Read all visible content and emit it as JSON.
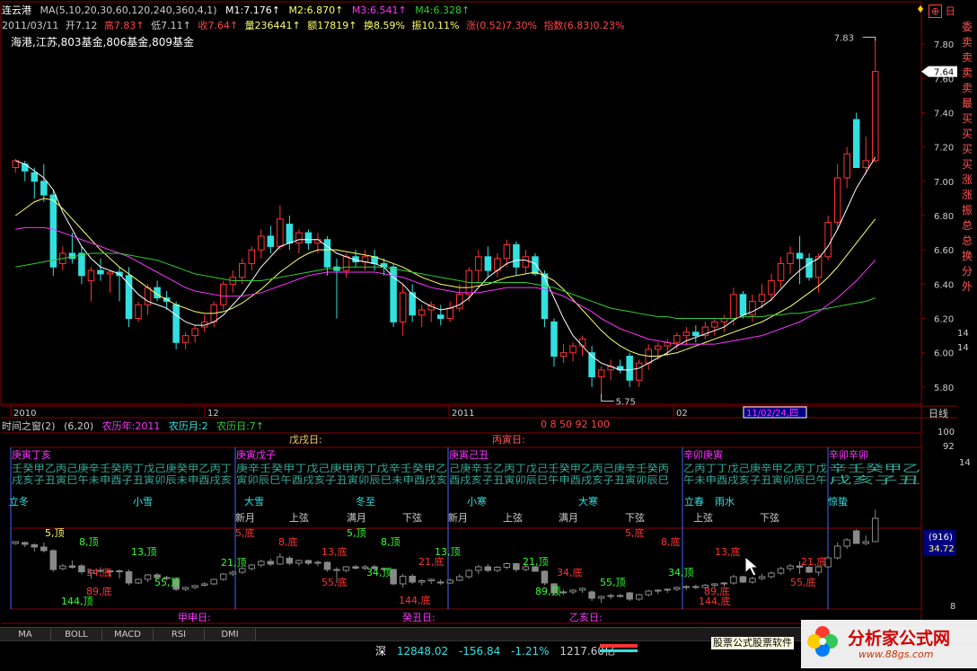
{
  "header": {
    "stock_name": "连云港",
    "ma_params": "MA(5,10,20,30,60,120,240,360,4,1)",
    "m1": "M1:7.176↑",
    "m2": "M2:6.870↑",
    "m3": "M3:6.541↑",
    "m4": "M4:6.328↑",
    "date": "2011/03/11",
    "open": "开7.12",
    "high": "高7.83↑",
    "low": "低7.11↑",
    "close": "收7.64↑",
    "volume": "量236441↑",
    "amount": "额17819↑",
    "turnover": "换8.59%",
    "amplitude": "振10.11%",
    "change": "涨(0.52)7.30%",
    "index": "指数(6.83)0.23%",
    "tags": "海港,江苏,803基金,806基金,809基金"
  },
  "top_right": {
    "tabs_label": "日"
  },
  "colors": {
    "bg": "#000000",
    "up": "#ff3333",
    "down": "#33e0e0",
    "ma_white": "#ffffff",
    "ma_yellow": "#ffff66",
    "ma_green": "#33cc33",
    "ma_magenta": "#ff33ff",
    "grid": "#8b0000",
    "axis_text": "#cccccc"
  },
  "price_axis": {
    "ticks": [
      "7.80",
      "7.60",
      "7.40",
      "7.20",
      "7.00",
      "6.80",
      "6.60",
      "6.40",
      "6.20",
      "6.00",
      "5.80"
    ],
    "current_price": "7.64",
    "high_label": "7.83",
    "low_label": "5.75",
    "side_labels": [
      "14",
      "14"
    ]
  },
  "date_axis": {
    "labels": [
      "2010",
      "12",
      "2011",
      "02"
    ],
    "cursor_date": "11/02/24,四",
    "period": "日线"
  },
  "sidebar": {
    "labels": [
      "委",
      "卖",
      "卖",
      "卖",
      "卖",
      "最",
      "买",
      "买",
      "买",
      "买",
      "涨",
      "涨",
      "振",
      "总",
      "总",
      "换",
      "分",
      "外"
    ]
  },
  "chart_data": {
    "type": "candlestick",
    "ylim": [
      5.7,
      7.9
    ],
    "candles": [
      {
        "o": 7.08,
        "h": 7.13,
        "l": 7.05,
        "c": 7.12
      },
      {
        "o": 7.1,
        "h": 7.12,
        "l": 7.0,
        "c": 7.06
      },
      {
        "o": 7.05,
        "h": 7.08,
        "l": 6.9,
        "c": 7.0
      },
      {
        "o": 7.0,
        "h": 7.1,
        "l": 6.88,
        "c": 6.92
      },
      {
        "o": 6.92,
        "h": 6.95,
        "l": 6.45,
        "c": 6.5
      },
      {
        "o": 6.52,
        "h": 6.62,
        "l": 6.48,
        "c": 6.58
      },
      {
        "o": 6.58,
        "h": 6.7,
        "l": 6.52,
        "c": 6.55
      },
      {
        "o": 6.58,
        "h": 6.62,
        "l": 6.4,
        "c": 6.45
      },
      {
        "o": 6.42,
        "h": 6.5,
        "l": 6.3,
        "c": 6.48
      },
      {
        "o": 6.48,
        "h": 6.55,
        "l": 6.42,
        "c": 6.46
      },
      {
        "o": 6.46,
        "h": 6.48,
        "l": 6.35,
        "c": 6.47
      },
      {
        "o": 6.47,
        "h": 6.5,
        "l": 6.3,
        "c": 6.45
      },
      {
        "o": 6.45,
        "h": 6.5,
        "l": 6.15,
        "c": 6.2
      },
      {
        "o": 6.2,
        "h": 6.3,
        "l": 6.18,
        "c": 6.28
      },
      {
        "o": 6.28,
        "h": 6.4,
        "l": 6.22,
        "c": 6.38
      },
      {
        "o": 6.38,
        "h": 6.42,
        "l": 6.3,
        "c": 6.32
      },
      {
        "o": 6.32,
        "h": 6.36,
        "l": 6.25,
        "c": 6.3
      },
      {
        "o": 6.28,
        "h": 6.3,
        "l": 6.02,
        "c": 6.06
      },
      {
        "o": 6.06,
        "h": 6.12,
        "l": 6.02,
        "c": 6.1
      },
      {
        "o": 6.1,
        "h": 6.16,
        "l": 6.06,
        "c": 6.14
      },
      {
        "o": 6.15,
        "h": 6.22,
        "l": 6.12,
        "c": 6.18
      },
      {
        "o": 6.18,
        "h": 6.3,
        "l": 6.15,
        "c": 6.28
      },
      {
        "o": 6.28,
        "h": 6.42,
        "l": 6.25,
        "c": 6.4
      },
      {
        "o": 6.4,
        "h": 6.48,
        "l": 6.35,
        "c": 6.44
      },
      {
        "o": 6.44,
        "h": 6.55,
        "l": 6.4,
        "c": 6.52
      },
      {
        "o": 6.52,
        "h": 6.62,
        "l": 6.48,
        "c": 6.6
      },
      {
        "o": 6.6,
        "h": 6.72,
        "l": 6.55,
        "c": 6.68
      },
      {
        "o": 6.68,
        "h": 6.74,
        "l": 6.58,
        "c": 6.62
      },
      {
        "o": 6.62,
        "h": 6.86,
        "l": 6.6,
        "c": 6.78
      },
      {
        "o": 6.75,
        "h": 6.8,
        "l": 6.6,
        "c": 6.64
      },
      {
        "o": 6.64,
        "h": 6.72,
        "l": 6.58,
        "c": 6.7
      },
      {
        "o": 6.7,
        "h": 6.72,
        "l": 6.6,
        "c": 6.64
      },
      {
        "o": 6.64,
        "h": 6.7,
        "l": 6.58,
        "c": 6.66
      },
      {
        "o": 6.66,
        "h": 6.68,
        "l": 6.45,
        "c": 6.5
      },
      {
        "o": 6.5,
        "h": 6.55,
        "l": 6.2,
        "c": 6.48
      },
      {
        "o": 6.48,
        "h": 6.58,
        "l": 6.44,
        "c": 6.56
      },
      {
        "o": 6.56,
        "h": 6.6,
        "l": 6.5,
        "c": 6.53
      },
      {
        "o": 6.53,
        "h": 6.6,
        "l": 6.48,
        "c": 6.56
      },
      {
        "o": 6.56,
        "h": 6.6,
        "l": 6.48,
        "c": 6.52
      },
      {
        "o": 6.52,
        "h": 6.55,
        "l": 6.45,
        "c": 6.5
      },
      {
        "o": 6.5,
        "h": 6.52,
        "l": 6.15,
        "c": 6.18
      },
      {
        "o": 6.18,
        "h": 6.4,
        "l": 6.1,
        "c": 6.35
      },
      {
        "o": 6.35,
        "h": 6.4,
        "l": 6.18,
        "c": 6.22
      },
      {
        "o": 6.22,
        "h": 6.28,
        "l": 6.15,
        "c": 6.25
      },
      {
        "o": 6.25,
        "h": 6.3,
        "l": 6.18,
        "c": 6.28
      },
      {
        "o": 6.22,
        "h": 6.28,
        "l": 6.16,
        "c": 6.2
      },
      {
        "o": 6.2,
        "h": 6.3,
        "l": 6.18,
        "c": 6.26
      },
      {
        "o": 6.26,
        "h": 6.4,
        "l": 6.24,
        "c": 6.34
      },
      {
        "o": 6.34,
        "h": 6.5,
        "l": 6.3,
        "c": 6.48
      },
      {
        "o": 6.48,
        "h": 6.6,
        "l": 6.4,
        "c": 6.56
      },
      {
        "o": 6.56,
        "h": 6.62,
        "l": 6.44,
        "c": 6.48
      },
      {
        "o": 6.48,
        "h": 6.58,
        "l": 6.44,
        "c": 6.55
      },
      {
        "o": 6.55,
        "h": 6.66,
        "l": 6.5,
        "c": 6.63
      },
      {
        "o": 6.63,
        "h": 6.65,
        "l": 6.45,
        "c": 6.5
      },
      {
        "o": 6.5,
        "h": 6.6,
        "l": 6.46,
        "c": 6.56
      },
      {
        "o": 6.56,
        "h": 6.58,
        "l": 6.45,
        "c": 6.46
      },
      {
        "o": 6.46,
        "h": 6.48,
        "l": 6.15,
        "c": 6.2
      },
      {
        "o": 6.18,
        "h": 6.2,
        "l": 5.92,
        "c": 5.98
      },
      {
        "o": 5.98,
        "h": 6.05,
        "l": 5.94,
        "c": 6.0
      },
      {
        "o": 6.0,
        "h": 6.06,
        "l": 5.95,
        "c": 6.04
      },
      {
        "o": 6.04,
        "h": 6.1,
        "l": 5.98,
        "c": 6.08
      },
      {
        "o": 6.0,
        "h": 6.04,
        "l": 5.8,
        "c": 5.86
      },
      {
        "o": 5.86,
        "h": 5.92,
        "l": 5.75,
        "c": 5.9
      },
      {
        "o": 5.9,
        "h": 5.96,
        "l": 5.84,
        "c": 5.92
      },
      {
        "o": 5.92,
        "h": 5.96,
        "l": 5.88,
        "c": 5.9
      },
      {
        "o": 5.98,
        "h": 6.0,
        "l": 5.8,
        "c": 5.84
      },
      {
        "o": 5.84,
        "h": 5.96,
        "l": 5.8,
        "c": 5.94
      },
      {
        "o": 5.94,
        "h": 6.05,
        "l": 5.9,
        "c": 6.02
      },
      {
        "o": 6.02,
        "h": 6.06,
        "l": 5.96,
        "c": 6.04
      },
      {
        "o": 6.04,
        "h": 6.08,
        "l": 5.98,
        "c": 6.06
      },
      {
        "o": 6.06,
        "h": 6.12,
        "l": 6.02,
        "c": 6.1
      },
      {
        "o": 6.1,
        "h": 6.15,
        "l": 6.04,
        "c": 6.12
      },
      {
        "o": 6.12,
        "h": 6.16,
        "l": 6.06,
        "c": 6.1
      },
      {
        "o": 6.1,
        "h": 6.18,
        "l": 6.08,
        "c": 6.15
      },
      {
        "o": 6.15,
        "h": 6.2,
        "l": 6.1,
        "c": 6.18
      },
      {
        "o": 6.18,
        "h": 6.22,
        "l": 6.12,
        "c": 6.2
      },
      {
        "o": 6.2,
        "h": 6.38,
        "l": 6.16,
        "c": 6.34
      },
      {
        "o": 6.34,
        "h": 6.36,
        "l": 6.2,
        "c": 6.22
      },
      {
        "o": 6.22,
        "h": 6.34,
        "l": 6.18,
        "c": 6.3
      },
      {
        "o": 6.3,
        "h": 6.4,
        "l": 6.26,
        "c": 6.34
      },
      {
        "o": 6.34,
        "h": 6.46,
        "l": 6.3,
        "c": 6.42
      },
      {
        "o": 6.42,
        "h": 6.56,
        "l": 6.38,
        "c": 6.52
      },
      {
        "o": 6.52,
        "h": 6.62,
        "l": 6.46,
        "c": 6.58
      },
      {
        "o": 6.58,
        "h": 6.68,
        "l": 6.4,
        "c": 6.55
      },
      {
        "o": 6.55,
        "h": 6.58,
        "l": 6.42,
        "c": 6.44
      },
      {
        "o": 6.44,
        "h": 6.58,
        "l": 6.35,
        "c": 6.56
      },
      {
        "o": 6.56,
        "h": 6.8,
        "l": 6.54,
        "c": 6.76
      },
      {
        "o": 6.76,
        "h": 7.1,
        "l": 6.72,
        "c": 7.02
      },
      {
        "o": 7.02,
        "h": 7.2,
        "l": 6.96,
        "c": 7.16
      },
      {
        "o": 7.36,
        "h": 7.4,
        "l": 7.08,
        "c": 7.08
      },
      {
        "o": 7.08,
        "h": 7.26,
        "l": 7.04,
        "c": 7.12
      },
      {
        "o": 7.12,
        "h": 7.83,
        "l": 7.11,
        "c": 7.64
      }
    ],
    "series": [
      {
        "name": "M1",
        "values": [
          7.12,
          7.1,
          7.06,
          7.02,
          6.95,
          6.82,
          6.72,
          6.62,
          6.55,
          6.5,
          6.48,
          6.46,
          6.4,
          6.34,
          6.3,
          6.28,
          6.26,
          6.22,
          6.18,
          6.16,
          6.16,
          6.18,
          6.22,
          6.28,
          6.34,
          6.42,
          6.5,
          6.56,
          6.62,
          6.64,
          6.66,
          6.66,
          6.66,
          6.62,
          6.58,
          6.56,
          6.54,
          6.53,
          6.52,
          6.5,
          6.44,
          6.4,
          6.34,
          6.3,
          6.27,
          6.25,
          6.26,
          6.28,
          6.32,
          6.38,
          6.44,
          6.48,
          6.52,
          6.54,
          6.54,
          6.52,
          6.44,
          6.32,
          6.2,
          6.1,
          6.04,
          5.98,
          5.94,
          5.92,
          5.9,
          5.9,
          5.91,
          5.94,
          5.97,
          6.0,
          6.04,
          6.07,
          6.09,
          6.11,
          6.13,
          6.15,
          6.19,
          6.22,
          6.24,
          6.27,
          6.31,
          6.37,
          6.43,
          6.48,
          6.52,
          6.55,
          6.62,
          6.72,
          6.84,
          6.96,
          7.05,
          7.14
        ]
      },
      {
        "name": "M2",
        "values": [
          6.8,
          6.84,
          6.88,
          6.9,
          6.89,
          6.84,
          6.78,
          6.72,
          6.66,
          6.6,
          6.55,
          6.5,
          6.46,
          6.42,
          6.38,
          6.34,
          6.31,
          6.28,
          6.26,
          6.24,
          6.23,
          6.23,
          6.24,
          6.26,
          6.29,
          6.33,
          6.37,
          6.42,
          6.47,
          6.51,
          6.55,
          6.58,
          6.6,
          6.6,
          6.6,
          6.59,
          6.58,
          6.57,
          6.56,
          6.54,
          6.52,
          6.5,
          6.47,
          6.44,
          6.42,
          6.4,
          6.39,
          6.38,
          6.38,
          6.39,
          6.4,
          6.42,
          6.44,
          6.45,
          6.46,
          6.47,
          6.45,
          6.42,
          6.37,
          6.31,
          6.25,
          6.19,
          6.13,
          6.08,
          6.04,
          6.01,
          5.99,
          5.98,
          5.98,
          5.99,
          6.0,
          6.02,
          6.04,
          6.06,
          6.08,
          6.1,
          6.12,
          6.14,
          6.16,
          6.18,
          6.21,
          6.24,
          6.27,
          6.31,
          6.35,
          6.39,
          6.44,
          6.5,
          6.57,
          6.64,
          6.71,
          6.78
        ]
      },
      {
        "name": "M3",
        "values": [
          6.72,
          6.73,
          6.73,
          6.73,
          6.72,
          6.7,
          6.68,
          6.66,
          6.64,
          6.62,
          6.6,
          6.58,
          6.56,
          6.53,
          6.5,
          6.47,
          6.44,
          6.41,
          6.38,
          6.36,
          6.35,
          6.34,
          6.33,
          6.33,
          6.33,
          6.34,
          6.35,
          6.37,
          6.39,
          6.41,
          6.43,
          6.45,
          6.46,
          6.47,
          6.47,
          6.47,
          6.47,
          6.47,
          6.47,
          6.46,
          6.45,
          6.44,
          6.42,
          6.4,
          6.38,
          6.37,
          6.36,
          6.35,
          6.35,
          6.35,
          6.36,
          6.37,
          6.38,
          6.38,
          6.38,
          6.38,
          6.37,
          6.35,
          6.33,
          6.3,
          6.27,
          6.24,
          6.2,
          6.17,
          6.14,
          6.12,
          6.1,
          6.08,
          6.07,
          6.06,
          6.05,
          6.05,
          6.05,
          6.05,
          6.05,
          6.06,
          6.07,
          6.08,
          6.09,
          6.1,
          6.12,
          6.14,
          6.16,
          6.18,
          6.21,
          6.24,
          6.28,
          6.32,
          6.37,
          6.42,
          6.48,
          6.54
        ]
      },
      {
        "name": "M4",
        "values": [
          6.5,
          6.51,
          6.52,
          6.53,
          6.54,
          6.55,
          6.56,
          6.57,
          6.58,
          6.58,
          6.58,
          6.58,
          6.57,
          6.56,
          6.55,
          6.54,
          6.52,
          6.5,
          6.48,
          6.46,
          6.45,
          6.44,
          6.43,
          6.42,
          6.42,
          6.42,
          6.42,
          6.43,
          6.44,
          6.45,
          6.46,
          6.47,
          6.48,
          6.49,
          6.49,
          6.5,
          6.5,
          6.5,
          6.5,
          6.5,
          6.49,
          6.48,
          6.47,
          6.46,
          6.45,
          6.44,
          6.43,
          6.42,
          6.41,
          6.41,
          6.41,
          6.41,
          6.41,
          6.41,
          6.41,
          6.4,
          6.39,
          6.38,
          6.36,
          6.34,
          6.32,
          6.3,
          6.28,
          6.26,
          6.25,
          6.24,
          6.23,
          6.22,
          6.21,
          6.21,
          6.2,
          6.2,
          6.2,
          6.2,
          6.2,
          6.2,
          6.2,
          6.21,
          6.21,
          6.21,
          6.22,
          6.22,
          6.23,
          6.23,
          6.24,
          6.25,
          6.26,
          6.27,
          6.28,
          6.29,
          6.3,
          6.32
        ]
      }
    ]
  },
  "pane2": {
    "title": "时间之窗(2)",
    "params": "(6,20)",
    "lunar_year": "农历年:2011",
    "lunar_month": "农历月:2",
    "lunar_day": "农历日:7↑",
    "values": "0 8 50 92 100",
    "top_labels": [
      "戊戌日:",
      "丙寅日:"
    ],
    "bottom_labels": [
      "甲申日:",
      "癸丑日:",
      "乙亥日:"
    ],
    "month_headers": [
      "庚寅丁亥",
      "庚寅戊子",
      "庚寅己丑",
      "辛卯庚寅",
      "辛卯辛卯"
    ],
    "ganzhi_row1": [
      "壬癸甲乙丙己庚辛壬癸丙丁戊己庚癸甲乙丙丁",
      "庚辛壬癸甲丁戊己庚甲丙丁戊辛壬癸甲乙",
      "己庚辛壬乙丙丁戊己壬癸甲乙丙己庚辛壬癸丙",
      "乙丙丁丁戊己庚辛甲乙丙丁戊",
      "辛壬癸甲乙"
    ],
    "ganzhi_row2": [
      "戌亥子丑寅巳午未申酉子丑寅卯辰未申酉戌亥",
      "寅卯辰巳午酉戌亥子丑寅卯辰巳未申酉戌亥",
      "酉戌亥子丑寅卯辰巳午申酉戌亥子丑寅卯辰巳",
      "午未申酉戌亥子丑寅卯辰巳午",
      "戌亥子丑"
    ],
    "solar_terms": [
      "立冬",
      "小雪",
      "大雪",
      "冬至",
      "小寒",
      "大寒",
      "立春",
      "雨水",
      "惊蛰"
    ],
    "moon_phases": [
      "新月",
      "上弦",
      "满月",
      "下弦",
      "新月",
      "上弦",
      "满月",
      "下弦",
      "上弦",
      "下弦"
    ],
    "fib_labels": [
      {
        "t": "5,顶",
        "c": "yellow"
      },
      {
        "t": "8,顶",
        "c": "lime"
      },
      {
        "t": "13,顶",
        "c": "lime"
      },
      {
        "t": "21,顶",
        "c": "lime"
      },
      {
        "t": "34,底",
        "c": "red"
      },
      {
        "t": "55,顶",
        "c": "lime"
      },
      {
        "t": "89,底",
        "c": "red"
      },
      {
        "t": "144,顶",
        "c": "lime"
      },
      {
        "t": "5,底",
        "c": "red"
      },
      {
        "t": "8,底",
        "c": "red"
      },
      {
        "t": "13,底",
        "c": "red"
      },
      {
        "t": "21,底",
        "c": "red"
      },
      {
        "t": "5,顶",
        "c": "lime"
      },
      {
        "t": "8,顶",
        "c": "lime"
      },
      {
        "t": "34,顶",
        "c": "lime"
      },
      {
        "t": "55,底",
        "c": "red"
      },
      {
        "t": "144,底",
        "c": "red"
      },
      {
        "t": "13,顶",
        "c": "lime"
      },
      {
        "t": "21,顶",
        "c": "lime"
      },
      {
        "t": "34,底",
        "c": "red"
      },
      {
        "t": "89,顶",
        "c": "lime"
      },
      {
        "t": "55,顶",
        "c": "lime"
      },
      {
        "t": "5,底",
        "c": "red"
      },
      {
        "t": "8,底",
        "c": "red"
      },
      {
        "t": "34,顶",
        "c": "lime"
      },
      {
        "t": "89,底",
        "c": "red"
      },
      {
        "t": "144,底",
        "c": "red"
      },
      {
        "t": "13,底",
        "c": "red"
      },
      {
        "t": "21,底",
        "c": "red"
      },
      {
        "t": "55,底",
        "c": "red"
      }
    ],
    "right_axis": [
      "100",
      "92",
      "14",
      "(916)",
      "34.72",
      "8"
    ]
  },
  "tabs": [
    "MA",
    "BOLL",
    "MACD",
    "RSI",
    "DMI"
  ],
  "ticker": {
    "market": "深",
    "index_value": "12848.02",
    "change": "-156.84",
    "pct": "-1.21%",
    "amount": "1217.60亿",
    "scroll_text": "股票公式股票软件"
  },
  "logo": {
    "name": "分析家公式网",
    "url": "www.88gs.com"
  }
}
